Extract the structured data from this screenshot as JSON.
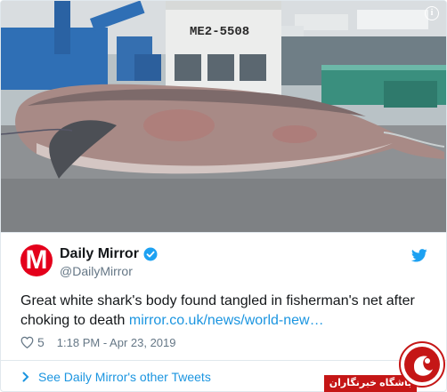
{
  "photo": {
    "boat_registration": "ME2-5508",
    "info_icon": "info-icon"
  },
  "tweet": {
    "avatar_letter": "M",
    "display_name": "Daily Mirror",
    "handle": "@DailyMirror",
    "text": "Great white shark's body found tangled in fisherman's net after choking to death ",
    "link_text": "mirror.co.uk/news/world-new…",
    "likes": "5",
    "timestamp": "1:18 PM - Apr 23, 2019",
    "more_tweets": "See Daily Mirror's other Tweets"
  },
  "watermark": {
    "label": "باشگاه خبرنگاران"
  },
  "colors": {
    "mirror_red": "#e4001b",
    "twitter_blue": "#1b95e0",
    "muted": "#657786"
  }
}
